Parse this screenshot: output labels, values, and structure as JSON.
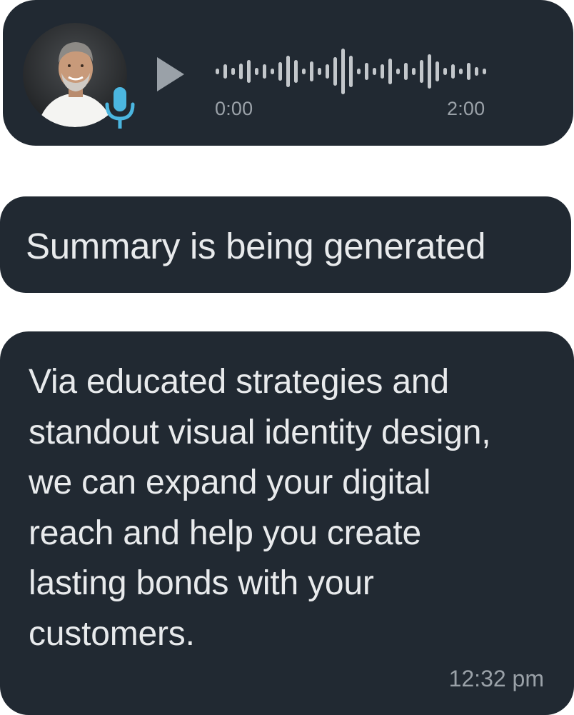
{
  "voice_message": {
    "avatar_icon": "person-avatar",
    "mic_icon": "microphone-icon",
    "play_icon": "play-icon",
    "current_time": "0:00",
    "duration": "2:00",
    "progress": 0
  },
  "summary": {
    "text": "Summary is being generated"
  },
  "message": {
    "lines": [
      "Via educated strategies and",
      "standout visual identity design,",
      "we can expand your digital",
      "reach and help you create",
      "lasting bonds with your",
      "customers."
    ],
    "timestamp": "12:32 pm"
  },
  "colors": {
    "bubble": "#212932",
    "text": "#e8eaec",
    "muted": "#9aa1a8",
    "mic_accent": "#4bb6e0"
  }
}
